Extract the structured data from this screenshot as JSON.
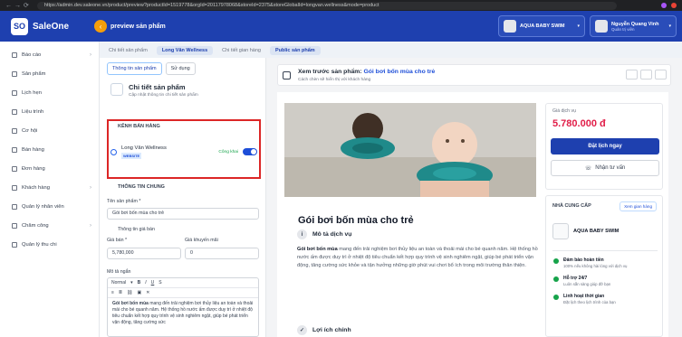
{
  "browser": {
    "url": "https://admin.dev.saleone.vn/product/preview?productId=1519778&orgId=20117978068&storeId=2375&storeGlobalId=longvan.wellness&mode=product"
  },
  "app": {
    "name": "SaleOne",
    "logo_text": "SO",
    "page_title": "preview sản phẩm",
    "accent": "#1e40af"
  },
  "topbar": {
    "store_name": "AQUA BABY SWIM",
    "user_name": "Nguyễn Quang Vinh",
    "user_role": "Quản trị viên"
  },
  "subtabs": [
    "Chi tiết sản phẩm",
    "Long Vân Wellness",
    "Chi tiết gian hàng",
    "Public sản phẩm"
  ],
  "sidebar": {
    "items": [
      {
        "label": "Báo cáo",
        "chevron": true
      },
      {
        "label": "Sản phẩm",
        "chevron": false
      },
      {
        "label": "Lịch hẹn",
        "chevron": false
      },
      {
        "label": "Liệu trình",
        "chevron": false
      },
      {
        "label": "Cơ hội",
        "chevron": false
      },
      {
        "label": "Bán hàng",
        "chevron": false
      },
      {
        "label": "Đơn hàng",
        "chevron": false
      },
      {
        "label": "Khách hàng",
        "chevron": true
      },
      {
        "label": "Quản lý nhân viên",
        "chevron": false
      },
      {
        "label": "Chăm công",
        "chevron": true
      },
      {
        "label": "Quản lý thu chi",
        "chevron": false
      }
    ]
  },
  "form": {
    "tabs": [
      "Thông tin sản phẩm",
      "Sử dụng"
    ],
    "section_title": "Chi tiết sản phẩm",
    "section_sub": "Cập nhật thông tin chi tiết sản phẩm",
    "sales_channel_title": "KÊNH BÁN HÀNG",
    "channel_name": "Long Vân Wellness",
    "channel_badge": "WEBSITE",
    "channel_status": "Công khai",
    "general_title": "THÔNG TIN CHUNG",
    "name_label": "Tên sản phẩm *",
    "name_value": "Gói bơi bốn mùa cho trẻ",
    "price_section": "Thông tin giá bán",
    "price_label": "Giá bán *",
    "price_value": "5,780,000",
    "promo_label": "Giá khuyến mãi",
    "promo_value": "0",
    "desc_label": "Mô tả ngắn",
    "editor_style": "Normal",
    "editor_text_bold": "Gói bơi bốn mùa",
    "editor_text": " mang đến trải nghiệm bơi thủy liệu an toàn và thoải mái cho bé quanh năm. Hệ thống hồ nước ấm được duy trì ở nhiệt độ tiêu chuẩn kết hợp quy trình vệ sinh nghiêm ngặt, giúp bé phát triển vận động, tăng cường sức"
  },
  "preview": {
    "header_prefix": "Xem trước sản phẩm:",
    "header_product": "Gói bơi bốn mùa cho trẻ",
    "header_sub": "Cách chèn sẽ hiển thị với khách hàng",
    "title": "Gói bơi bốn mùa cho trẻ",
    "desc_heading": "Mô tả dịch vụ",
    "desc_bold": "Gói bơi bốn mùa",
    "desc_text": " mang đến trải nghiệm bơi thủy liệu an toàn và thoải mái cho bé quanh năm. Hệ thống hồ nước ấm được duy trì ở nhiệt độ tiêu chuẩn kết hợp quy trình vệ sinh nghiêm ngặt, giúp bé phát triển vận động, tăng cường sức khỏe và tận hưởng những giờ phút vui chơi bổ ích trong môi trường thân thiện.",
    "benefits_heading": "Lợi ích chính",
    "price_label": "Giá dịch vụ",
    "price_value": "5.780.000 đ",
    "book_button": "Đặt lịch ngay",
    "consult_button": "Nhận tư vấn",
    "supplier_heading": "NHÀ CUNG CẤP",
    "view_store": "Xem gian hàng",
    "supplier_name": "AQUA BABY SWIM",
    "features": [
      {
        "title": "Đảm bảo hoàn tiền",
        "sub": "100% nếu không hài lòng với dịch vụ"
      },
      {
        "title": "Hỗ trợ 24/7",
        "sub": "Luôn sẵn sàng giúp đỡ bạn"
      },
      {
        "title": "Linh hoạt thời gian",
        "sub": "Đặt lịch theo lịch trình của bạn"
      }
    ],
    "price_color": "#e11d48"
  }
}
